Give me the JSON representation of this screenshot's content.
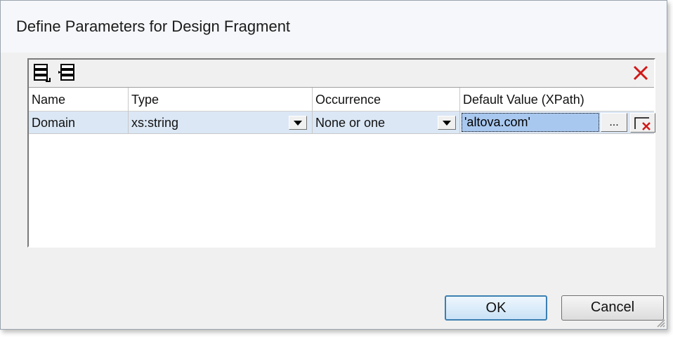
{
  "window": {
    "title": "Define Parameters for Design Fragment"
  },
  "toolbar": {
    "icons": [
      "append-row-icon",
      "insert-row-icon",
      "delete-row-icon"
    ]
  },
  "grid": {
    "columns": [
      "Name",
      "Type",
      "Occurrence",
      "Default Value (XPath)"
    ],
    "rows": [
      {
        "name": "Domain",
        "type": "xs:string",
        "occurrence": "None or one",
        "default_value": "'altova.com'",
        "browse_label": "..."
      }
    ]
  },
  "buttons": {
    "ok": "OK",
    "cancel": "Cancel"
  },
  "colors": {
    "selected_row": "#dbe7f5",
    "edit_highlight": "#a9c8ef",
    "ok_border": "#3c7fb1",
    "delete_red": "#d01818"
  }
}
